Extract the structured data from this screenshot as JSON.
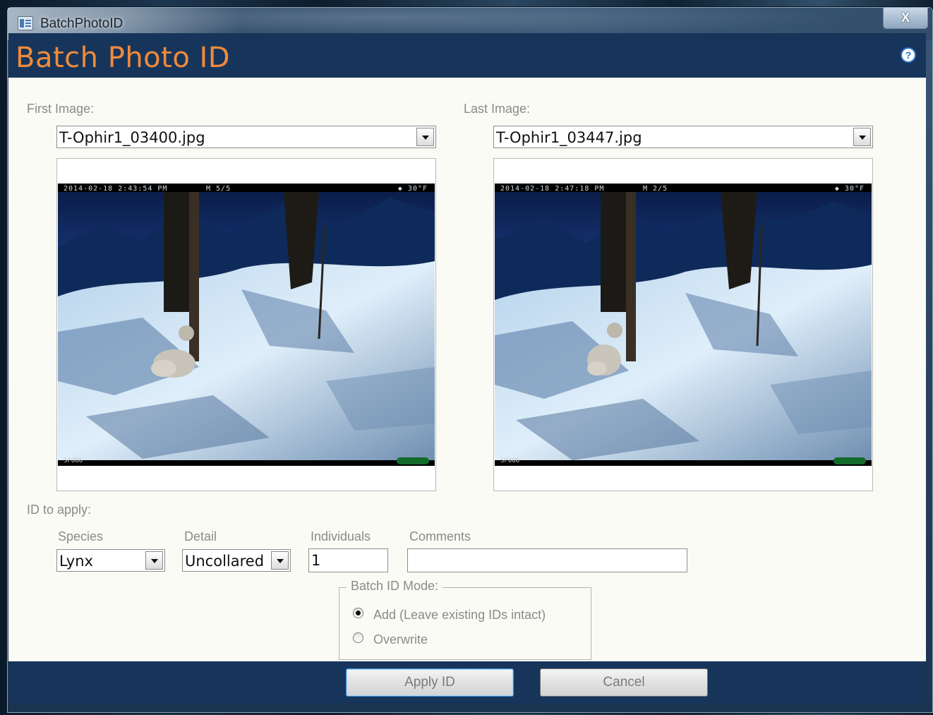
{
  "window": {
    "title": "BatchPhotoID",
    "close_label": "X"
  },
  "header": {
    "title": "Batch Photo ID",
    "help_icon": "?"
  },
  "first_image": {
    "label": "First Image:",
    "value": "T-Ophir1_03400.jpg",
    "timestamp": "2014-02-18 2:43:54 PM",
    "counter": "M 5/5",
    "temperature": "◆ 30°F",
    "footer_id": "SFOOO"
  },
  "last_image": {
    "label": "Last Image:",
    "value": "T-Ophir1_03447.jpg",
    "timestamp": "2014-02-18 2:47:18 PM",
    "counter": "M 2/5",
    "temperature": "◆ 30°F",
    "footer_id": "SFOOO"
  },
  "id_section": {
    "label": "ID to apply:",
    "species_label": "Species",
    "species_value": "Lynx",
    "detail_label": "Detail",
    "detail_value": "Uncollared",
    "individuals_label": "Individuals",
    "individuals_value": "1",
    "comments_label": "Comments",
    "comments_value": ""
  },
  "batch_mode": {
    "title": "Batch ID Mode:",
    "options": [
      {
        "label": "Add (Leave existing IDs intact)",
        "selected": true
      },
      {
        "label": "Overwrite",
        "selected": false
      }
    ]
  },
  "footer": {
    "apply_label": "Apply ID",
    "cancel_label": "Cancel"
  },
  "colors": {
    "header_band": "#17355a",
    "title_orange": "#f08a3c",
    "content_bg": "#fbfbf5",
    "label_gray": "#8a8a8a"
  }
}
